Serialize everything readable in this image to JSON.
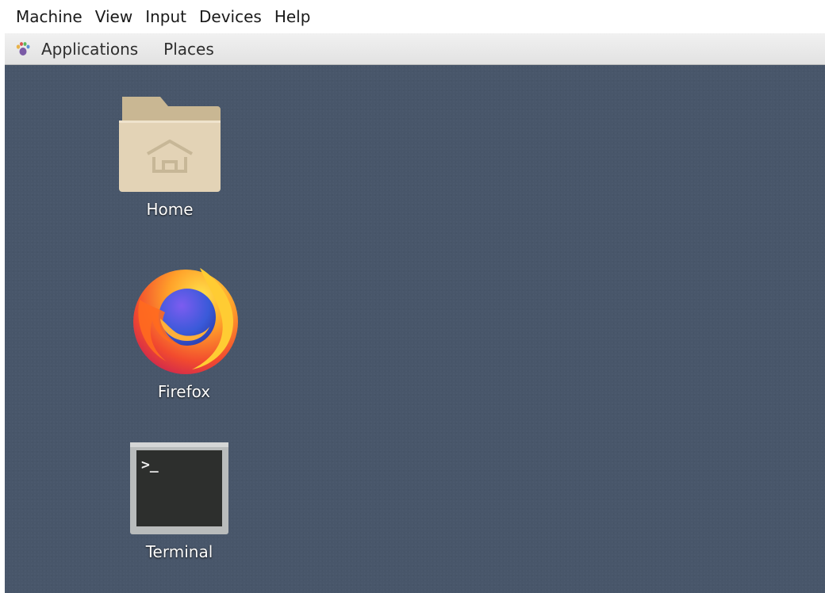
{
  "vm_menubar": {
    "items": [
      "Machine",
      "View",
      "Input",
      "Devices",
      "Help"
    ]
  },
  "panel": {
    "applications_label": "Applications",
    "places_label": "Places",
    "applications_icon": "gnome-foot-icon"
  },
  "desktop": {
    "icons": [
      {
        "label": "Home",
        "icon": "home-folder-icon"
      },
      {
        "label": "Firefox",
        "icon": "firefox-icon"
      },
      {
        "label": "Terminal",
        "icon": "terminal-icon"
      }
    ]
  },
  "colors": {
    "desktop_background": "#48566a",
    "panel_background": "#e9e9e9",
    "folder": "#e2d1b3",
    "terminal_screen": "#2d2f2d"
  }
}
